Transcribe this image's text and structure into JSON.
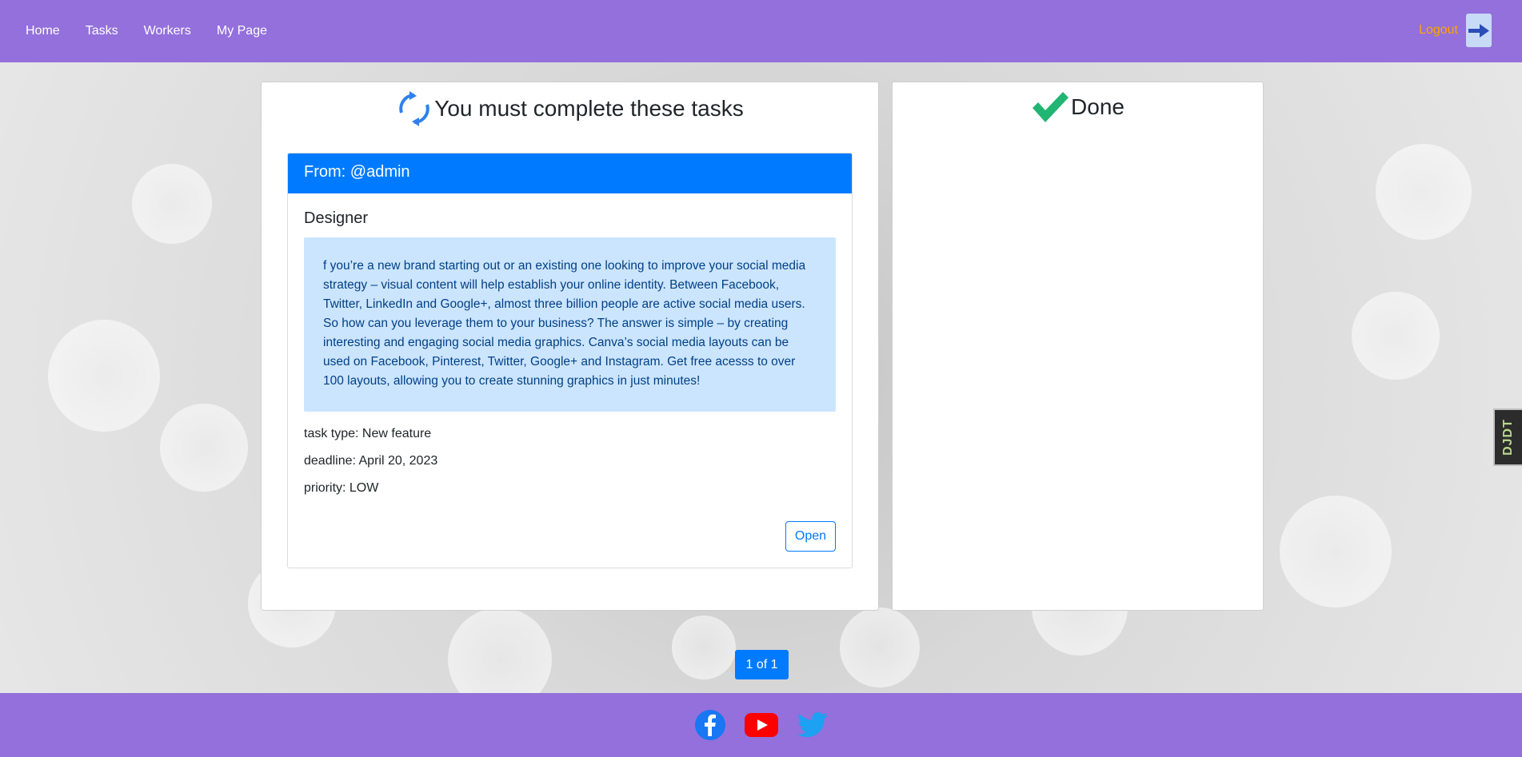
{
  "navbar": {
    "links": [
      {
        "label": "Home"
      },
      {
        "label": "Tasks"
      },
      {
        "label": "Workers"
      },
      {
        "label": "My Page"
      }
    ],
    "logout_label": "Logout"
  },
  "todo_panel": {
    "title": "You must complete these tasks",
    "task": {
      "header": "From: @admin",
      "title": "Designer",
      "description": "f you’re a new brand starting out or an existing one looking to improve your social media strategy – visual content will help establish your online identity. Between Facebook, Twitter, LinkedIn and Google+, almost three billion people are active social media users. So how can you leverage them to your business? The answer is simple – by creating interesting and engaging social media graphics. Canva’s social media layouts can be used on Facebook, Pinterest, Twitter, Google+ and Instagram. Get free acesss to over 100 layouts, allowing you to create stunning graphics in just minutes!",
      "type": "task type: New feature",
      "deadline": "deadline: April 20, 2023",
      "priority": "priority: LOW",
      "open_label": "Open"
    }
  },
  "done_panel": {
    "title": "Done"
  },
  "pagination": {
    "label": "1 of 1"
  },
  "footer": {
    "icons": [
      "facebook-icon",
      "youtube-icon",
      "twitter-icon"
    ]
  },
  "debug_toolbar": {
    "label": "DJDT"
  },
  "colors": {
    "navbar": "#9370db",
    "primary": "#007bff",
    "logout": "#ffa500",
    "alert_bg": "#cce5ff",
    "alert_text": "#004085",
    "check": "#21b573",
    "sync": "#2f80ed"
  }
}
